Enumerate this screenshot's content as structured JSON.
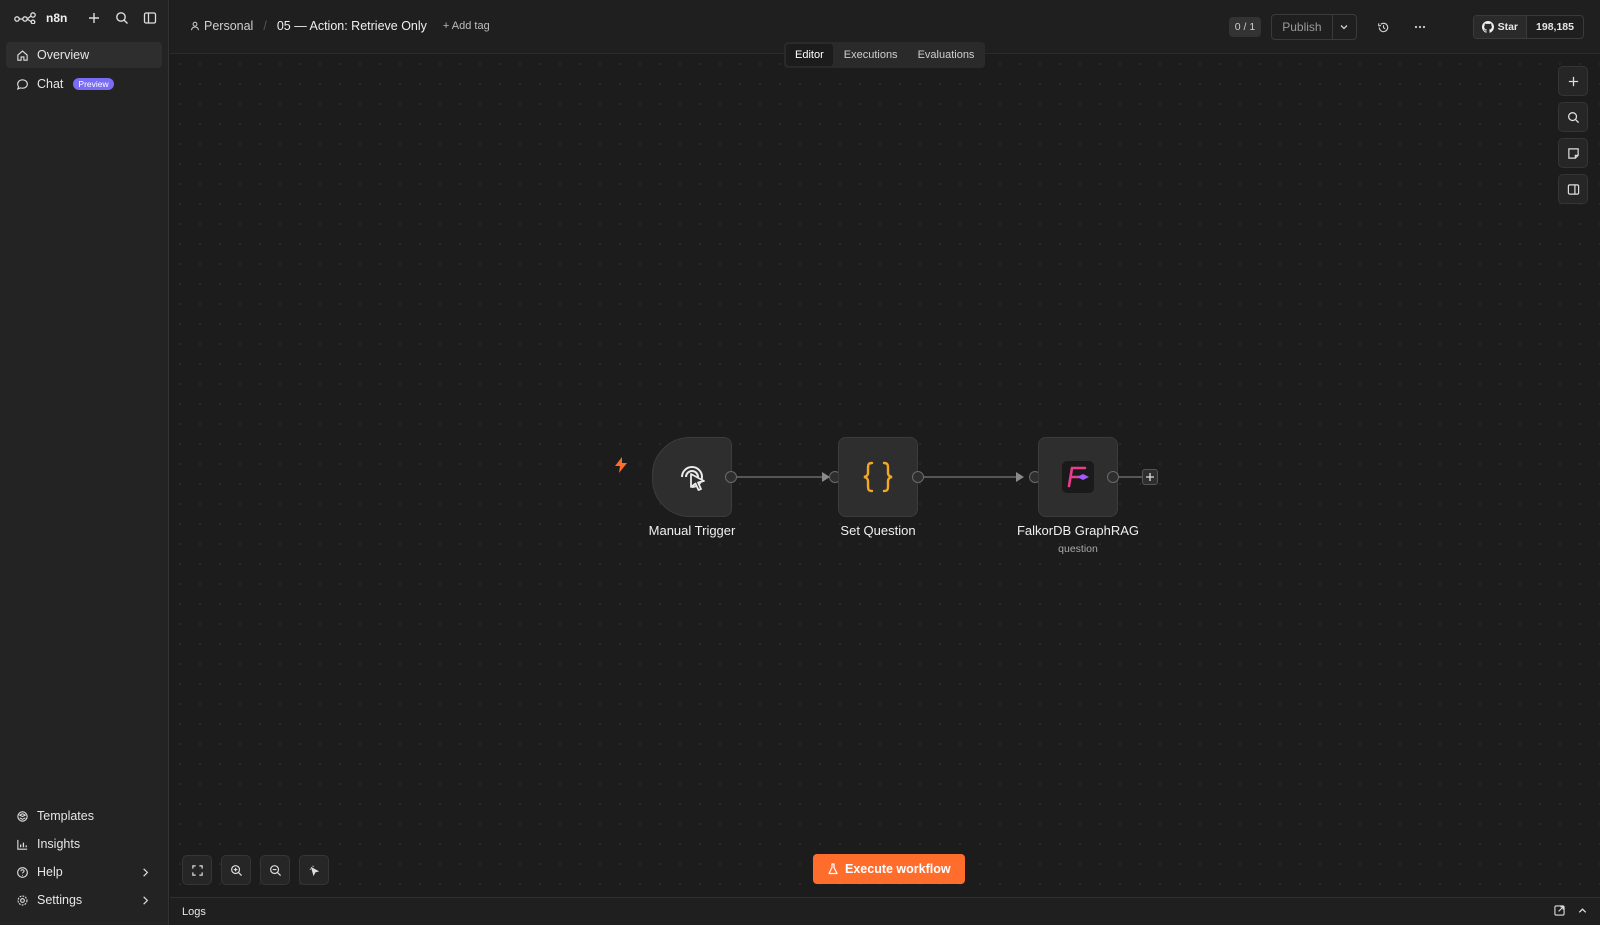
{
  "sidebar": {
    "brand": "n8n",
    "items": [
      {
        "label": "Overview"
      },
      {
        "label": "Chat",
        "badge": "Preview"
      }
    ],
    "bottom": [
      {
        "label": "Templates"
      },
      {
        "label": "Insights"
      },
      {
        "label": "Help"
      },
      {
        "label": "Settings"
      }
    ]
  },
  "header": {
    "project": "Personal",
    "title": "05 — Action: Retrieve Only",
    "add_tag": "+ Add tag",
    "counter": "0 / 1",
    "publish": "Publish",
    "github_star": "Star",
    "github_count": "198,185"
  },
  "tabs": [
    "Editor",
    "Executions",
    "Evaluations"
  ],
  "nodes": [
    {
      "label": "Manual Trigger"
    },
    {
      "label": "Set Question"
    },
    {
      "label": "FalkorDB GraphRAG",
      "subtitle": "question"
    }
  ],
  "execute_label": "Execute workflow",
  "logs_label": "Logs",
  "colors": {
    "accent": "#ff6d2d",
    "badge": "#7b6cf6",
    "set_node_braces": "#f5a623",
    "falkor_brand": "#e83e8c"
  }
}
